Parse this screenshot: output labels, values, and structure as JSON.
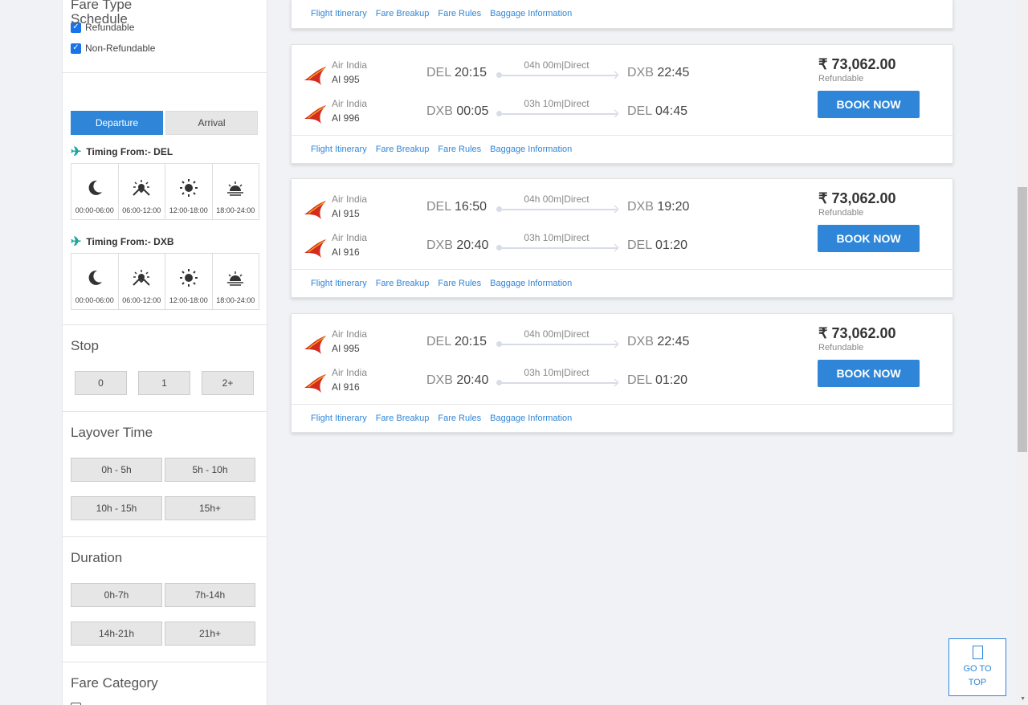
{
  "sidebar": {
    "fare_type": {
      "title": "Fare Type",
      "options": [
        {
          "label": "Refundable",
          "checked": true
        },
        {
          "label": "Non-Refundable",
          "checked": true
        }
      ]
    },
    "schedule": {
      "title": "Schedule",
      "tabs": [
        "Departure",
        "Arrival"
      ],
      "active_tab": "Departure",
      "groups": [
        {
          "label": "Timing From:- DEL",
          "slots": [
            "00:00-06:00",
            "06:00-12:00",
            "12:00-18:00",
            "18:00-24:00"
          ]
        },
        {
          "label": "Timing From:- DXB",
          "slots": [
            "00:00-06:00",
            "06:00-12:00",
            "12:00-18:00",
            "18:00-24:00"
          ]
        }
      ]
    },
    "stop": {
      "title": "Stop",
      "options": [
        "0",
        "1",
        "2+"
      ]
    },
    "layover": {
      "title": "Layover Time",
      "options": [
        "0h - 5h",
        "5h - 10h",
        "10h - 15h",
        "15h+"
      ]
    },
    "duration": {
      "title": "Duration",
      "options": [
        "0h-7h",
        "7h-14h",
        "14h-21h",
        "21h+"
      ]
    },
    "fare_category": {
      "title": "Fare Category"
    }
  },
  "card_links": [
    "Flight Itinerary",
    "Fare Breakup",
    "Fare Rules",
    "Baggage Information"
  ],
  "results": [
    {
      "price": "₹ 73,062.00",
      "fare": "Refundable",
      "book_label": "BOOK NOW",
      "legs": [
        {
          "airline": "Air India",
          "flight": "AI  995",
          "from_code": "DEL",
          "dep": "20:15",
          "duration": "04h 00m|Direct",
          "to_code": "DXB",
          "arr": "22:45"
        },
        {
          "airline": "Air India",
          "flight": "AI  996",
          "from_code": "DXB",
          "dep": "00:05",
          "duration": "03h 10m|Direct",
          "to_code": "DEL",
          "arr": "04:45"
        }
      ]
    },
    {
      "price": "₹ 73,062.00",
      "fare": "Refundable",
      "book_label": "BOOK NOW",
      "legs": [
        {
          "airline": "Air India",
          "flight": "AI  915",
          "from_code": "DEL",
          "dep": "16:50",
          "duration": "04h 00m|Direct",
          "to_code": "DXB",
          "arr": "19:20"
        },
        {
          "airline": "Air India",
          "flight": "AI  916",
          "from_code": "DXB",
          "dep": "20:40",
          "duration": "03h 10m|Direct",
          "to_code": "DEL",
          "arr": "01:20"
        }
      ]
    },
    {
      "price": "₹ 73,062.00",
      "fare": "Refundable",
      "book_label": "BOOK NOW",
      "legs": [
        {
          "airline": "Air India",
          "flight": "AI  995",
          "from_code": "DEL",
          "dep": "20:15",
          "duration": "04h 00m|Direct",
          "to_code": "DXB",
          "arr": "22:45"
        },
        {
          "airline": "Air India",
          "flight": "AI  916",
          "from_code": "DXB",
          "dep": "20:40",
          "duration": "03h 10m|Direct",
          "to_code": "DEL",
          "arr": "01:20"
        }
      ]
    }
  ],
  "go_to_top": {
    "line1": "GO TO",
    "line2": "TOP"
  },
  "colors": {
    "accent": "#2f86d8",
    "plane": "#1aa39a",
    "airline_logo": "#d42a1f"
  }
}
